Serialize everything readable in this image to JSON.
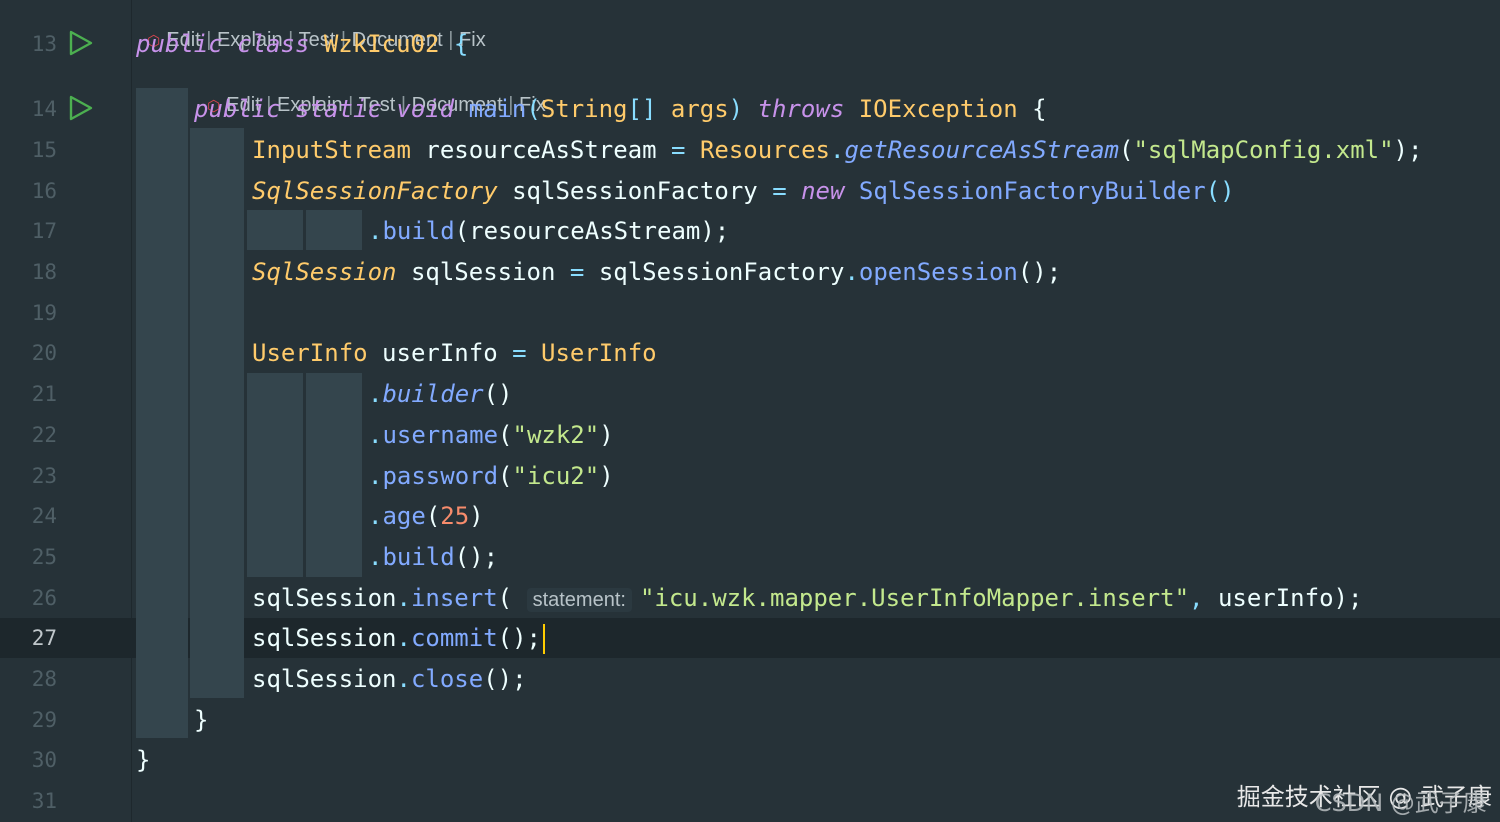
{
  "editor": {
    "code_lens": {
      "actions": [
        "Edit",
        "Explain",
        "Test",
        "Document",
        "Fix"
      ],
      "separator": " | "
    },
    "line_numbers": [
      "13",
      "14",
      "15",
      "16",
      "17",
      "18",
      "19",
      "20",
      "21",
      "22",
      "23",
      "24",
      "25",
      "26",
      "27",
      "28",
      "29",
      "30",
      "31"
    ],
    "current_line": "27",
    "lines": {
      "l13": {
        "public": "public",
        "class": "class",
        "name": "WzkIcu02",
        "brace": "{"
      },
      "l14": {
        "public": "public",
        "static": "static",
        "void": "void",
        "main": "main",
        "lparen": "(",
        "string": "String",
        "arr": "[]",
        "args": "args",
        "rparen": ")",
        "throws": "throws",
        "exc": "IOException",
        "brace": "{"
      },
      "l15": {
        "type": "InputStream",
        "var": "resourceAsStream",
        "eq": "=",
        "cls": "Resources",
        "dot": ".",
        "fn": "getResourceAsStream",
        "lp": "(",
        "str": "\"sqlMapConfig.xml\"",
        "rp": ");"
      },
      "l16": {
        "type": "SqlSessionFactory",
        "var": "sqlSessionFactory",
        "eq": "=",
        "new": "new",
        "cls": "SqlSessionFactoryBuilder",
        "parens": "()"
      },
      "l17": {
        "dot": ".",
        "fn": "build",
        "lp": "(",
        "arg": "resourceAsStream",
        "rp": ");"
      },
      "l18": {
        "type": "SqlSession",
        "var": "sqlSession",
        "eq": "=",
        "obj": "sqlSessionFactory",
        "dot": ".",
        "fn": "openSession",
        "rp": "();"
      },
      "l20": {
        "type": "UserInfo",
        "var": "userInfo",
        "eq": "=",
        "cls": "UserInfo"
      },
      "l21": {
        "dot": ".",
        "fn": "builder",
        "parens": "()"
      },
      "l22": {
        "dot": ".",
        "fn": "username",
        "lp": "(",
        "str": "\"wzk2\"",
        "rp": ")"
      },
      "l23": {
        "dot": ".",
        "fn": "password",
        "lp": "(",
        "str": "\"icu2\"",
        "rp": ")"
      },
      "l24": {
        "dot": ".",
        "fn": "age",
        "lp": "(",
        "num": "25",
        "rp": ")"
      },
      "l25": {
        "dot": ".",
        "fn": "build",
        "rp": "();"
      },
      "l26": {
        "obj": "sqlSession",
        "dot": ".",
        "fn": "insert",
        "lp": "(",
        "hint": "statement:",
        "str": "\"icu.wzk.mapper.UserInfoMapper.insert\"",
        "comma": ",",
        "arg": "userInfo",
        "rp": ");"
      },
      "l27": {
        "obj": "sqlSession",
        "dot": ".",
        "fn": "commit",
        "rp": "();"
      },
      "l28": {
        "obj": "sqlSession",
        "dot": ".",
        "fn": "close",
        "rp": "();"
      },
      "l29": {
        "brace": "}"
      },
      "l30": {
        "brace": "}"
      }
    }
  },
  "watermark": {
    "main": "掘金技术社区 @ 武子康",
    "overlay": "CSDN @武子康"
  },
  "colors": {
    "background": "#263238",
    "keyword": "#c792ea",
    "type": "#ffcb6b",
    "function": "#82aaff",
    "string": "#c3e88d",
    "number": "#f78c6c",
    "punctuation": "#89ddff",
    "text": "#eeffff",
    "caret": "#ffcc00"
  },
  "icons": {
    "run": "run-triangle-icon",
    "ai": "ai-assistant-icon"
  }
}
